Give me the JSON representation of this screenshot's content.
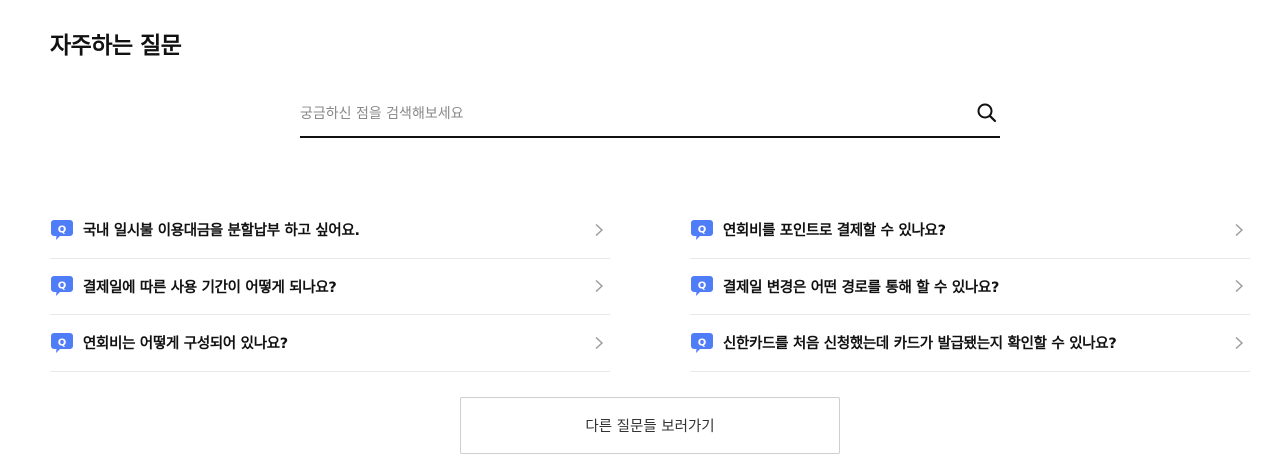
{
  "page": {
    "title": "자주하는 질문"
  },
  "search": {
    "placeholder": "궁금하신 점을 검색해보세요",
    "value": "",
    "icon": "search-icon"
  },
  "faq": {
    "badge_letter": "Q",
    "badge_color": "#4f7cf7",
    "left": [
      {
        "question": "국내 일시불 이용대금을 분할납부 하고 싶어요."
      },
      {
        "question": "결제일에 따른 사용 기간이 어떻게 되나요?"
      },
      {
        "question": "연회비는 어떻게 구성되어 있나요?"
      }
    ],
    "right": [
      {
        "question": "연회비를 포인트로 결제할 수 있나요?"
      },
      {
        "question": "결제일 변경은 어떤 경로를 통해 할 수 있나요?"
      },
      {
        "question": "신한카드를 처음 신청했는데 카드가 발급됐는지 확인할 수 있나요?"
      }
    ]
  },
  "more_button": {
    "label": "다른 질문들 보러가기"
  }
}
